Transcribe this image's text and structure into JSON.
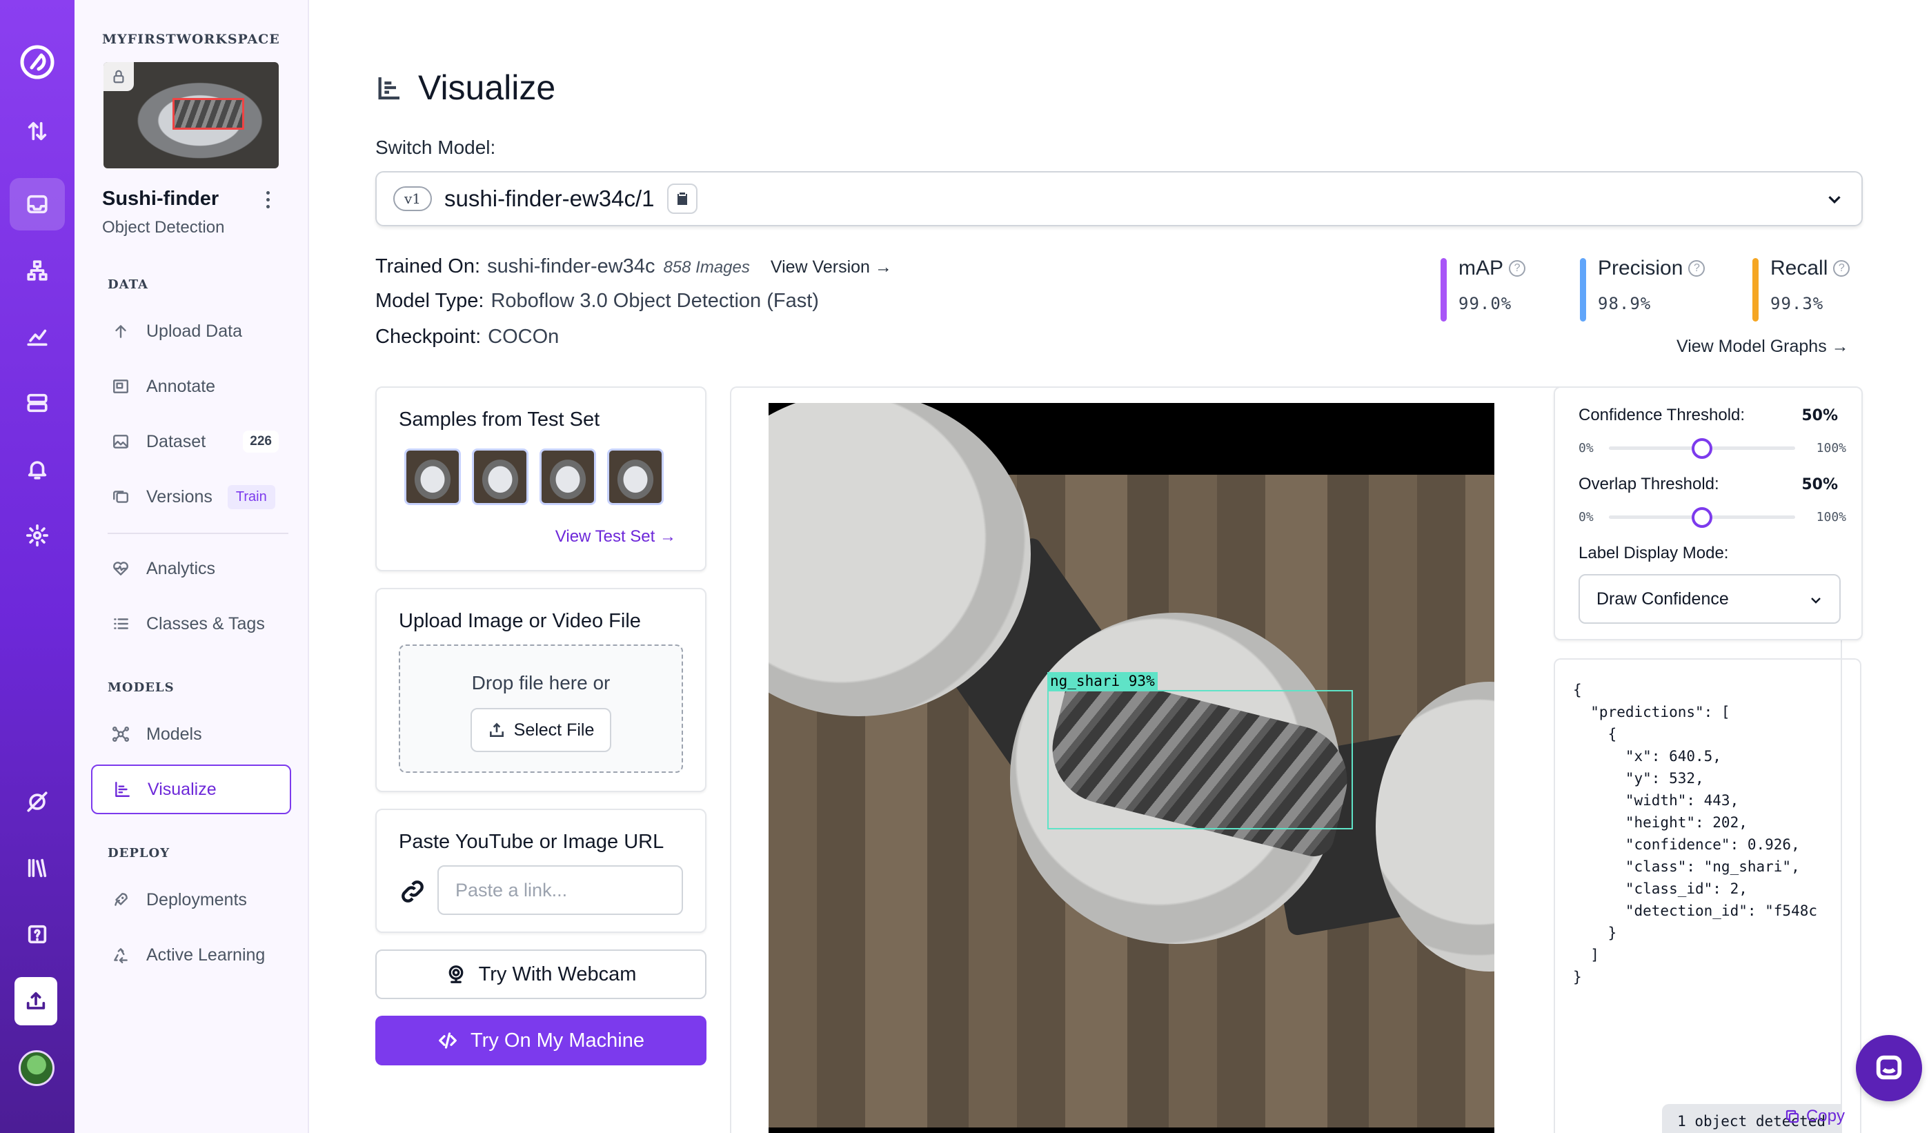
{
  "workspace": {
    "name": "MYFIRSTWORKSPACE"
  },
  "project": {
    "name": "Sushi-finder",
    "type": "Object Detection"
  },
  "sidebar": {
    "data_heading": "DATA",
    "models_heading": "MODELS",
    "deploy_heading": "DEPLOY",
    "items": [
      {
        "label": "Upload Data",
        "icon": "upload-arrow-icon"
      },
      {
        "label": "Annotate",
        "icon": "annotate-icon"
      },
      {
        "label": "Dataset",
        "icon": "image-icon",
        "count": "226"
      },
      {
        "label": "Versions",
        "icon": "versions-icon",
        "badge": "Train"
      },
      {
        "label": "Analytics",
        "icon": "analytics-heart-icon"
      },
      {
        "label": "Classes & Tags",
        "icon": "list-icon"
      },
      {
        "label": "Models",
        "icon": "models-icon"
      },
      {
        "label": "Visualize",
        "icon": "visualize-chart-icon",
        "active": true
      },
      {
        "label": "Deployments",
        "icon": "rocket-icon"
      },
      {
        "label": "Active Learning",
        "icon": "recycle-icon"
      }
    ]
  },
  "page": {
    "title": "Visualize"
  },
  "switch_model": {
    "label": "Switch Model:",
    "version": "v1",
    "model_id": "sushi-finder-ew34c/1"
  },
  "model_info": {
    "trained_on_label": "Trained On:",
    "trained_on_value": "sushi-finder-ew34c",
    "image_count": "858 Images",
    "view_version": "View Version →",
    "model_type_label": "Model Type:",
    "model_type_value": "Roboflow 3.0 Object Detection (Fast)",
    "checkpoint_label": "Checkpoint:",
    "checkpoint_value": "COCOn"
  },
  "metrics": [
    {
      "label": "mAP",
      "value": "99.0%",
      "color": "#a855f7"
    },
    {
      "label": "Precision",
      "value": "98.9%",
      "color": "#60a5fa"
    },
    {
      "label": "Recall",
      "value": "99.3%",
      "color": "#f5a623"
    }
  ],
  "view_model_graphs": "View Model Graphs →",
  "samples_card": {
    "title": "Samples from Test Set",
    "link": "View Test Set →"
  },
  "upload_card": {
    "title": "Upload Image or Video File",
    "drop_text": "Drop file here or",
    "button": "Select File"
  },
  "url_card": {
    "title": "Paste YouTube or Image URL",
    "placeholder": "Paste a link..."
  },
  "webcam_button": "Try With Webcam",
  "machine_button": "Try On My Machine",
  "detection": {
    "label": "ng_shari 93%",
    "count_text": "1 object detected",
    "box_color": "#5fe3c7"
  },
  "controls": {
    "confidence": {
      "label": "Confidence Threshold:",
      "value": "50%",
      "min": "0%",
      "max": "100%",
      "level": 0.5
    },
    "overlap": {
      "label": "Overlap Threshold:",
      "value": "50%",
      "min": "0%",
      "max": "100%",
      "level": 0.5
    },
    "display_mode_label": "Label Display Mode:",
    "display_mode_value": "Draw Confidence"
  },
  "json_output": "{\n  \"predictions\": [\n    {\n      \"x\": 640.5,\n      \"y\": 532,\n      \"width\": 443,\n      \"height\": 202,\n      \"confidence\": 0.926,\n      \"class\": \"ng_shari\",\n      \"class_id\": 2,\n      \"detection_id\": \"f548c\n    }\n  ]\n}",
  "json_copy": "Copy",
  "accent_color": "#7c3aed"
}
